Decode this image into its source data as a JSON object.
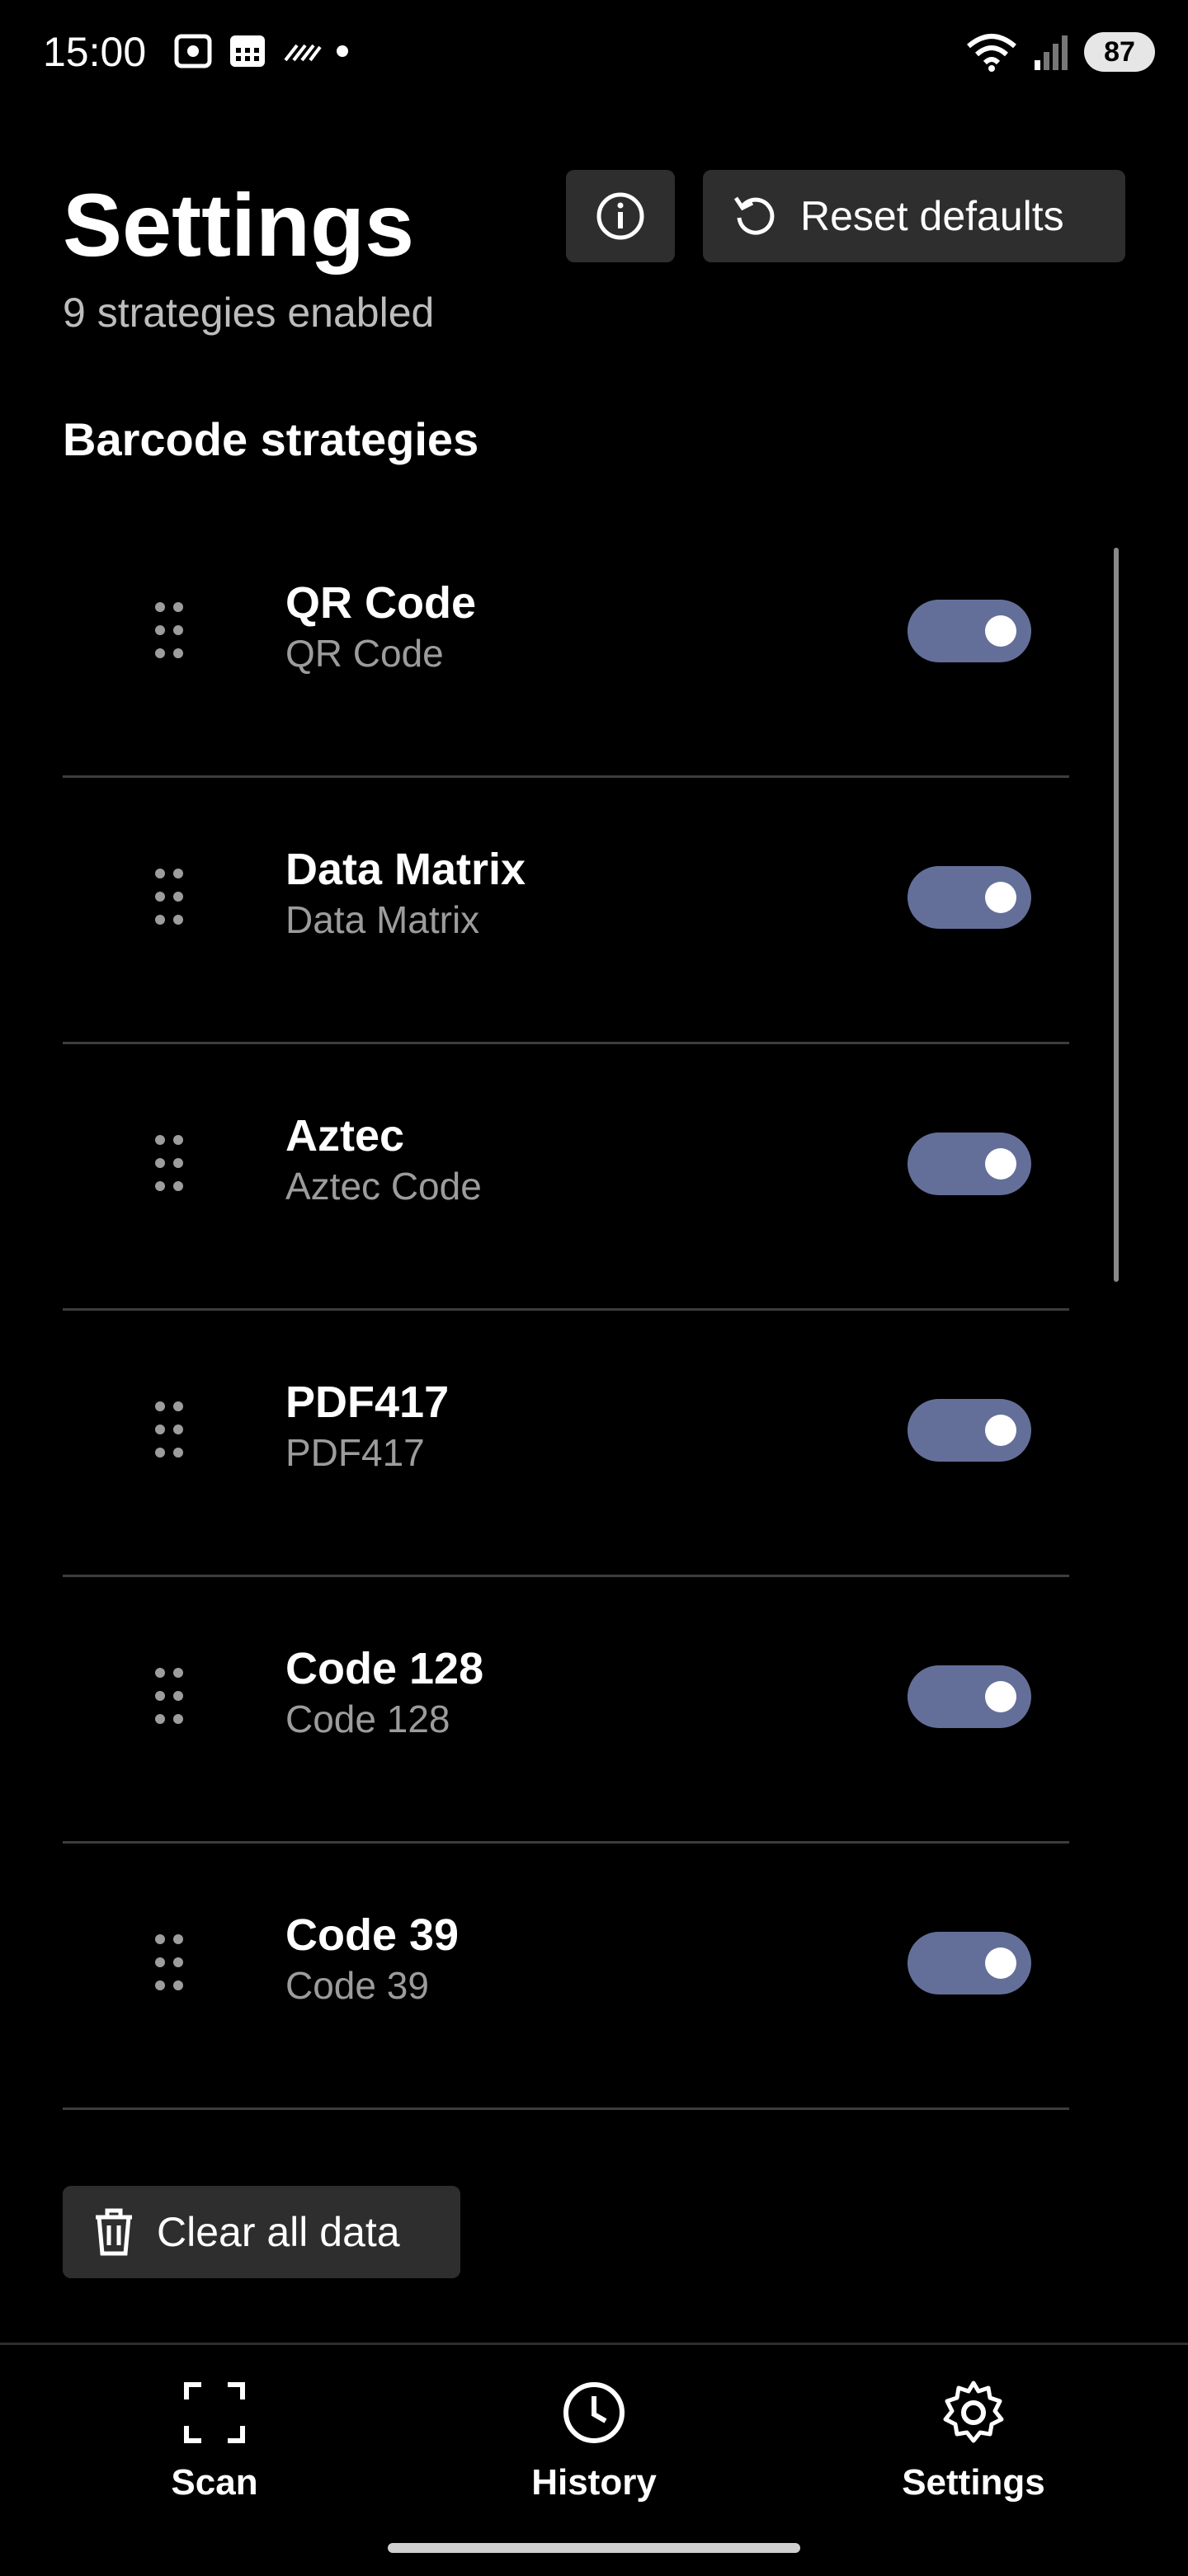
{
  "status_bar": {
    "time": "15:00",
    "battery": "87"
  },
  "header": {
    "title": "Settings",
    "subtitle": "9 strategies enabled",
    "reset_label": "Reset defaults"
  },
  "section": {
    "title": "Barcode strategies"
  },
  "strategies": [
    {
      "title": "QR Code",
      "subtitle": "QR Code",
      "enabled": true
    },
    {
      "title": "Data Matrix",
      "subtitle": "Data Matrix",
      "enabled": true
    },
    {
      "title": "Aztec",
      "subtitle": "Aztec Code",
      "enabled": true
    },
    {
      "title": "PDF417",
      "subtitle": "PDF417",
      "enabled": true
    },
    {
      "title": "Code 128",
      "subtitle": "Code 128",
      "enabled": true
    },
    {
      "title": "Code 39",
      "subtitle": "Code 39",
      "enabled": true
    }
  ],
  "actions": {
    "clear_label": "Clear all data"
  },
  "nav": {
    "scan": "Scan",
    "history": "History",
    "settings": "Settings"
  },
  "colors": {
    "toggle_on": "#646f99",
    "button_bg": "#2e2e2e",
    "background": "#000000"
  },
  "icons": {
    "info": "info-icon",
    "reset": "reset-icon",
    "drag": "drag-handle-icon",
    "trash": "trash-icon",
    "scan": "scan-icon",
    "history": "history-icon",
    "settings": "gear-icon"
  }
}
